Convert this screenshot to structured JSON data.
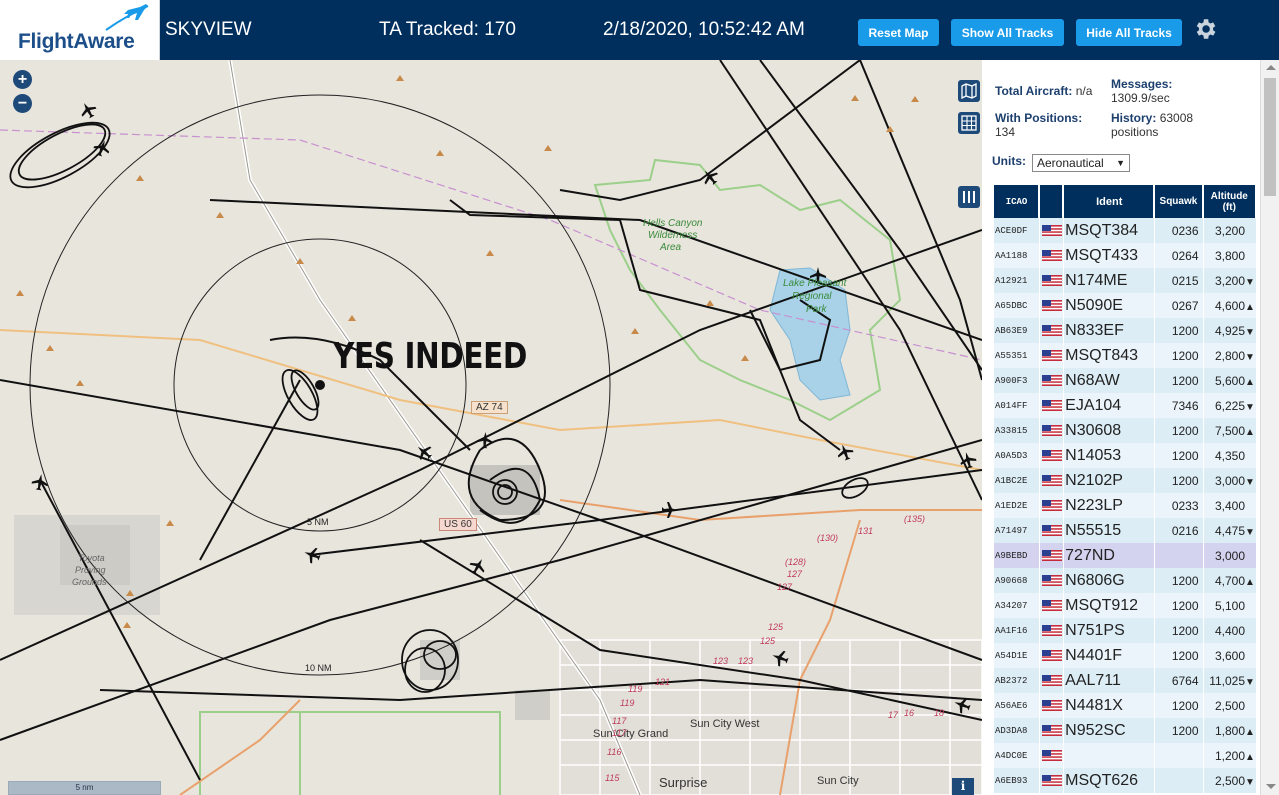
{
  "app": {
    "logo": "FlightAware",
    "title": "SKYVIEW",
    "tracked_label": "TA Tracked: 170",
    "datetime": "2/18/2020, 10:52:42 AM",
    "buttons": {
      "reset_map": "Reset Map",
      "show_all_tracks": "Show All Tracks",
      "hide_all_tracks": "Hide All Tracks"
    },
    "settings_icon": "gear-icon"
  },
  "map": {
    "overlay_text": "YES INDEED",
    "range_rings": [
      "5 NM",
      "10 NM"
    ],
    "place_labels": {
      "wilderness": [
        "Hells Canyon",
        "Wilderness",
        "Area"
      ],
      "park": [
        "Lake Pleasant",
        "Regional",
        "Park"
      ],
      "proving": [
        "Toyota",
        "Proving",
        "Grounds"
      ],
      "sun_city_grand": "Sun City Grand",
      "sun_city_west": "Sun City West",
      "surprise": "Surprise",
      "sun_city": "Sun City"
    },
    "road_shields": [
      "AZ 74",
      "US 60"
    ],
    "road_numbers": [
      "(130)",
      "131",
      "(135)",
      "(128)",
      "127",
      "127",
      "125",
      "125",
      "123",
      "123",
      "121",
      "119",
      "119",
      "117",
      "117",
      "116",
      "115",
      "17",
      "16",
      "18"
    ],
    "scale_label": "5 nm",
    "zoom_in": "+",
    "zoom_out": "−",
    "info": "i"
  },
  "sidebar": {
    "total_aircraft_label": "Total Aircraft:",
    "total_aircraft_value": "n/a",
    "messages_label": "Messages:",
    "messages_value": "1309.9/sec",
    "with_positions_label": "With Positions:",
    "with_positions_value": "134",
    "history_label": "History:",
    "history_value": "63008",
    "history_unit": "positions",
    "units_label": "Units:",
    "units_value": "Aeronautical",
    "columns": [
      "ICAO",
      "",
      "Ident",
      "Squawk",
      "Altitude (ft)"
    ],
    "rows": [
      {
        "icao": "ACE0DF",
        "ident": "MSQT384",
        "squawk": "0236",
        "alt": "3,200",
        "dir": ""
      },
      {
        "icao": "AA1188",
        "ident": "MSQT433",
        "squawk": "0264",
        "alt": "3,800",
        "dir": ""
      },
      {
        "icao": "A12921",
        "ident": "N174ME",
        "squawk": "0215",
        "alt": "3,200",
        "dir": "▼"
      },
      {
        "icao": "A65DBC",
        "ident": "N5090E",
        "squawk": "0267",
        "alt": "4,600",
        "dir": "▲"
      },
      {
        "icao": "AB63E9",
        "ident": "N833EF",
        "squawk": "1200",
        "alt": "4,925",
        "dir": "▼"
      },
      {
        "icao": "A55351",
        "ident": "MSQT843",
        "squawk": "1200",
        "alt": "2,800",
        "dir": "▼"
      },
      {
        "icao": "A900F3",
        "ident": "N68AW",
        "squawk": "1200",
        "alt": "5,600",
        "dir": "▲"
      },
      {
        "icao": "A014FF",
        "ident": "EJA104",
        "squawk": "7346",
        "alt": "6,225",
        "dir": "▼"
      },
      {
        "icao": "A33815",
        "ident": "N30608",
        "squawk": "1200",
        "alt": "7,500",
        "dir": "▲"
      },
      {
        "icao": "A0A5D3",
        "ident": "N14053",
        "squawk": "1200",
        "alt": "4,350",
        "dir": ""
      },
      {
        "icao": "A1BC2E",
        "ident": "N2102P",
        "squawk": "1200",
        "alt": "3,000",
        "dir": "▼"
      },
      {
        "icao": "A1ED2E",
        "ident": "N223LP",
        "squawk": "0233",
        "alt": "3,400",
        "dir": ""
      },
      {
        "icao": "A71497",
        "ident": "N55515",
        "squawk": "0216",
        "alt": "4,475",
        "dir": "▼"
      },
      {
        "icao": "A9BEBD",
        "ident": "727ND",
        "squawk": "",
        "alt": "3,000",
        "dir": ""
      },
      {
        "icao": "A90668",
        "ident": "N6806G",
        "squawk": "1200",
        "alt": "4,700",
        "dir": "▲"
      },
      {
        "icao": "A34207",
        "ident": "MSQT912",
        "squawk": "1200",
        "alt": "5,100",
        "dir": ""
      },
      {
        "icao": "AA1F16",
        "ident": "N751PS",
        "squawk": "1200",
        "alt": "4,400",
        "dir": ""
      },
      {
        "icao": "A54D1E",
        "ident": "N4401F",
        "squawk": "1200",
        "alt": "3,600",
        "dir": ""
      },
      {
        "icao": "AB2372",
        "ident": "AAL711",
        "squawk": "6764",
        "alt": "11,025",
        "dir": "▼"
      },
      {
        "icao": "A56AE6",
        "ident": "N4481X",
        "squawk": "1200",
        "alt": "2,500",
        "dir": ""
      },
      {
        "icao": "AD3DA8",
        "ident": "N952SC",
        "squawk": "1200",
        "alt": "1,800",
        "dir": "▲"
      },
      {
        "icao": "A4DC0E",
        "ident": "",
        "squawk": "",
        "alt": "1,200",
        "dir": "▲"
      },
      {
        "icao": "A6EB93",
        "ident": "MSQT626",
        "squawk": "",
        "alt": "2,500",
        "dir": "▼"
      }
    ],
    "selected_index": 13
  },
  "colors": {
    "header_bg": "#002f5d",
    "button": "#1a9bea",
    "row": "#dcedf6",
    "row_alt": "#eaf4fa",
    "row_selected": "#d3d3f0",
    "track": "#111111",
    "road_orange": "#e9a16c",
    "water": "#a9d2e8"
  }
}
